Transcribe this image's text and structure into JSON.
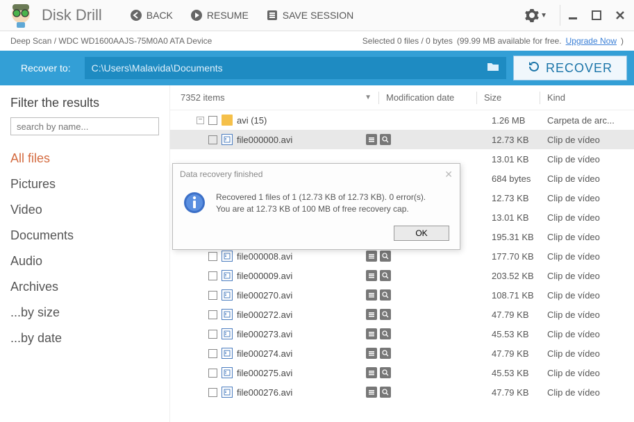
{
  "header": {
    "app_title": "Disk Drill",
    "back": "BACK",
    "resume": "RESUME",
    "save_session": "SAVE SESSION"
  },
  "infobar": {
    "left": "Deep Scan / WDC WD1600AAJS-75M0A0 ATA Device",
    "selected": "Selected 0 files / 0 bytes",
    "available": "(99.99 MB available for free.",
    "upgrade": "Upgrade Now",
    "close_paren": ")"
  },
  "recoverbar": {
    "label": "Recover to:",
    "path": "C:\\Users\\Malavida\\Documents",
    "button": "RECOVER"
  },
  "sidebar": {
    "title": "Filter the results",
    "search_placeholder": "search by name...",
    "filters": [
      "All files",
      "Pictures",
      "Video",
      "Documents",
      "Audio",
      "Archives",
      "...by size",
      "...by date"
    ]
  },
  "table": {
    "count": "7352 items",
    "col_mod": "Modification date",
    "col_size": "Size",
    "col_kind": "Kind",
    "folder": {
      "name": "avi (15)",
      "size": "1.26 MB",
      "kind": "Carpeta de arc..."
    },
    "files": [
      {
        "name": "file000000.avi",
        "size": "12.73 KB",
        "kind": "Clip de vídeo"
      },
      {
        "name": "",
        "size": "13.01 KB",
        "kind": "Clip de vídeo"
      },
      {
        "name": "",
        "size": "684 bytes",
        "kind": "Clip de vídeo"
      },
      {
        "name": "",
        "size": "12.73 KB",
        "kind": "Clip de vídeo"
      },
      {
        "name": "",
        "size": "13.01 KB",
        "kind": "Clip de vídeo"
      },
      {
        "name": "",
        "size": "195.31 KB",
        "kind": "Clip de vídeo"
      },
      {
        "name": "file000008.avi",
        "size": "177.70 KB",
        "kind": "Clip de vídeo"
      },
      {
        "name": "file000009.avi",
        "size": "203.52 KB",
        "kind": "Clip de vídeo"
      },
      {
        "name": "file000270.avi",
        "size": "108.71 KB",
        "kind": "Clip de vídeo"
      },
      {
        "name": "file000272.avi",
        "size": "47.79 KB",
        "kind": "Clip de vídeo"
      },
      {
        "name": "file000273.avi",
        "size": "45.53 KB",
        "kind": "Clip de vídeo"
      },
      {
        "name": "file000274.avi",
        "size": "47.79 KB",
        "kind": "Clip de vídeo"
      },
      {
        "name": "file000275.avi",
        "size": "45.53 KB",
        "kind": "Clip de vídeo"
      },
      {
        "name": "file000276.avi",
        "size": "47.79 KB",
        "kind": "Clip de vídeo"
      }
    ]
  },
  "modal": {
    "title": "Data recovery finished",
    "line1": "Recovered 1 files of 1 (12.73 KB of 12.73 KB). 0 error(s).",
    "line2": "You are at 12.73 KB of 100 MB of free recovery cap.",
    "ok": "OK"
  }
}
